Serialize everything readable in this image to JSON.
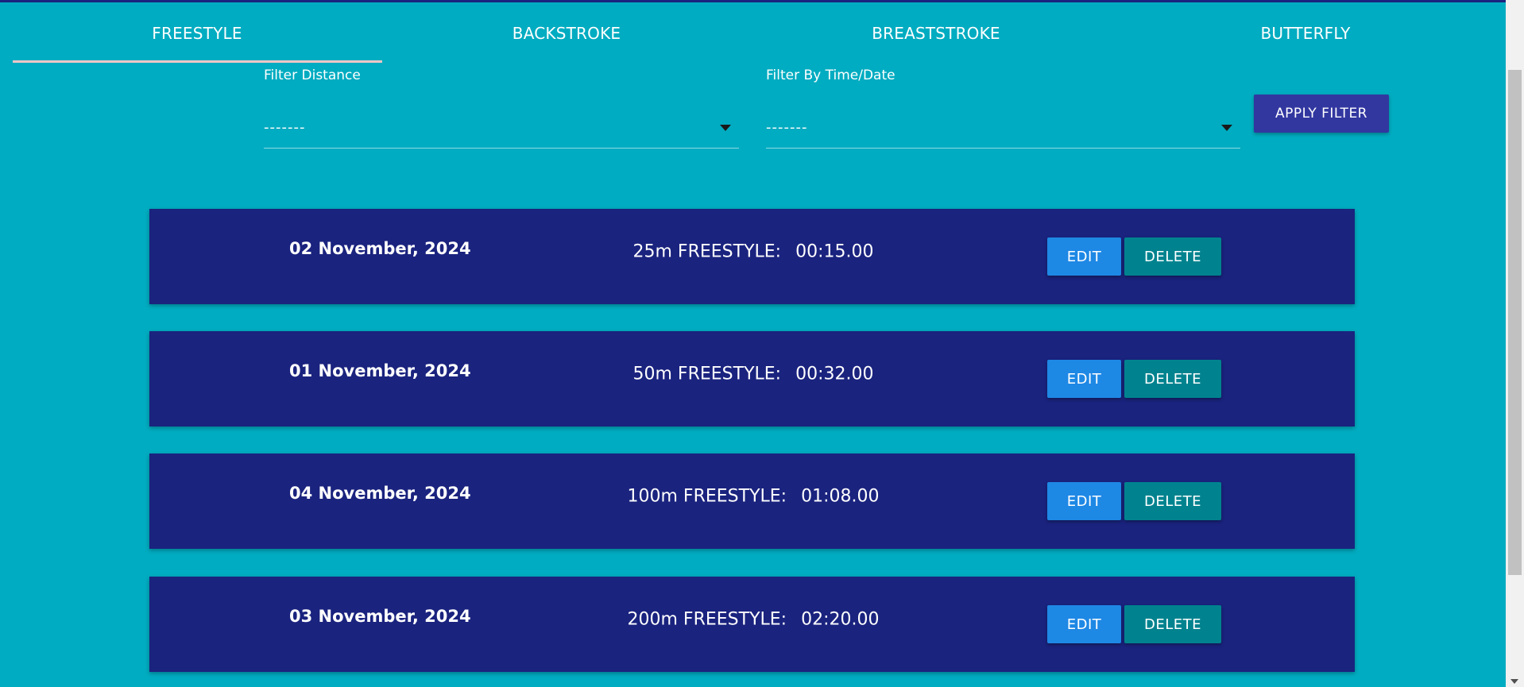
{
  "tabs": [
    {
      "label": "FREESTYLE",
      "active": true
    },
    {
      "label": "BACKSTROKE",
      "active": false
    },
    {
      "label": "BREASTSTROKE",
      "active": false
    },
    {
      "label": "BUTTERFLY",
      "active": false
    }
  ],
  "filters": {
    "distance": {
      "label": "Filter Distance",
      "value": "-------"
    },
    "date": {
      "label": "Filter By Time/Date",
      "value": "-------"
    },
    "apply_label": "APPLY FILTER"
  },
  "records": [
    {
      "date": "02 November, 2024",
      "event": "25m FREESTYLE:",
      "time": "00:15.00"
    },
    {
      "date": "01 November, 2024",
      "event": "50m FREESTYLE:",
      "time": "00:32.00"
    },
    {
      "date": "04 November, 2024",
      "event": "100m FREESTYLE:",
      "time": "01:08.00"
    },
    {
      "date": "03 November, 2024",
      "event": "200m FREESTYLE:",
      "time": "02:20.00"
    }
  ],
  "buttons": {
    "edit_label": "EDIT",
    "delete_label": "DELETE"
  },
  "colors": {
    "background": "#00acc1",
    "card": "#1a237e",
    "apply": "#3237a0",
    "edit": "#1e88e5",
    "delete": "#00838f",
    "tab_indicator": "#f4c6c6"
  }
}
